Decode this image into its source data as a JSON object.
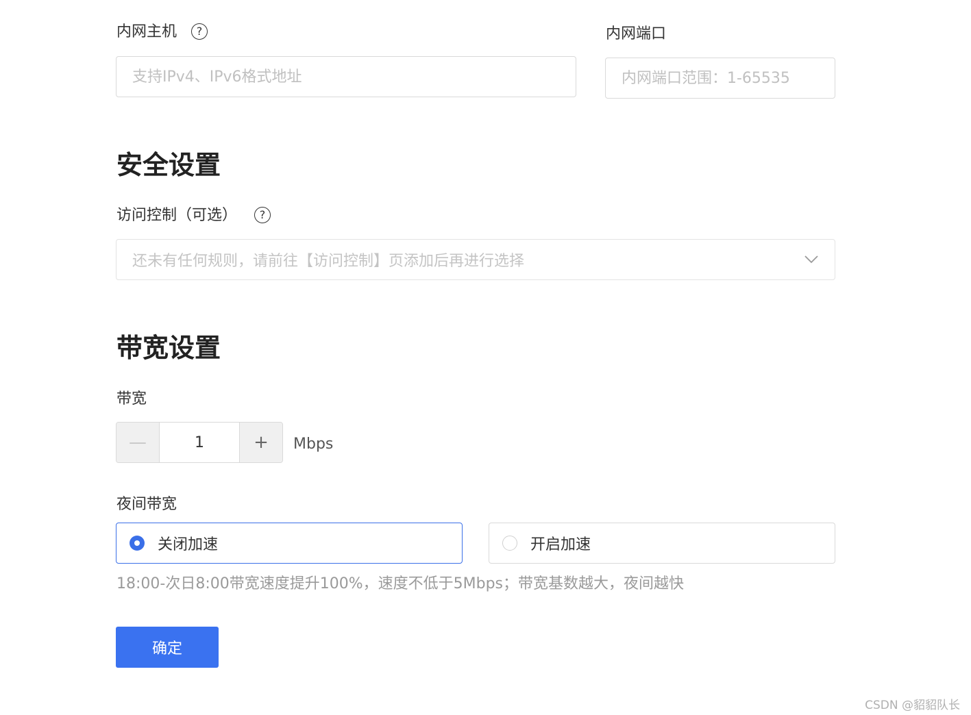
{
  "internal_host": {
    "label": "内网主机",
    "help_glyph": "?",
    "placeholder": "支持IPv4、IPv6格式地址",
    "value": ""
  },
  "internal_port": {
    "label": "内网端口",
    "placeholder": "内网端口范围：1-65535",
    "value": ""
  },
  "security": {
    "title": "安全设置",
    "access_control_label": "访问控制（可选）",
    "help_glyph": "?",
    "select_placeholder": "还未有任何规则，请前往【访问控制】页添加后再进行选择"
  },
  "bandwidth": {
    "title": "带宽设置",
    "label": "带宽",
    "minus": "—",
    "value": "1",
    "plus": "+",
    "unit": "Mbps"
  },
  "night_bandwidth": {
    "label": "夜间带宽",
    "options": [
      {
        "label": "关闭加速",
        "selected": true
      },
      {
        "label": "开启加速",
        "selected": false
      }
    ],
    "hint": "18:00-次日8:00带宽速度提升100%，速度不低于5Mbps；带宽基数越大，夜间越快"
  },
  "submit_label": "确定",
  "watermark": "CSDN @貂貂队长",
  "colors": {
    "primary": "#3a72f0",
    "radio_selected": "#3a6fe8",
    "placeholder": "#c0c0c0",
    "hint": "#9a9a9a"
  }
}
